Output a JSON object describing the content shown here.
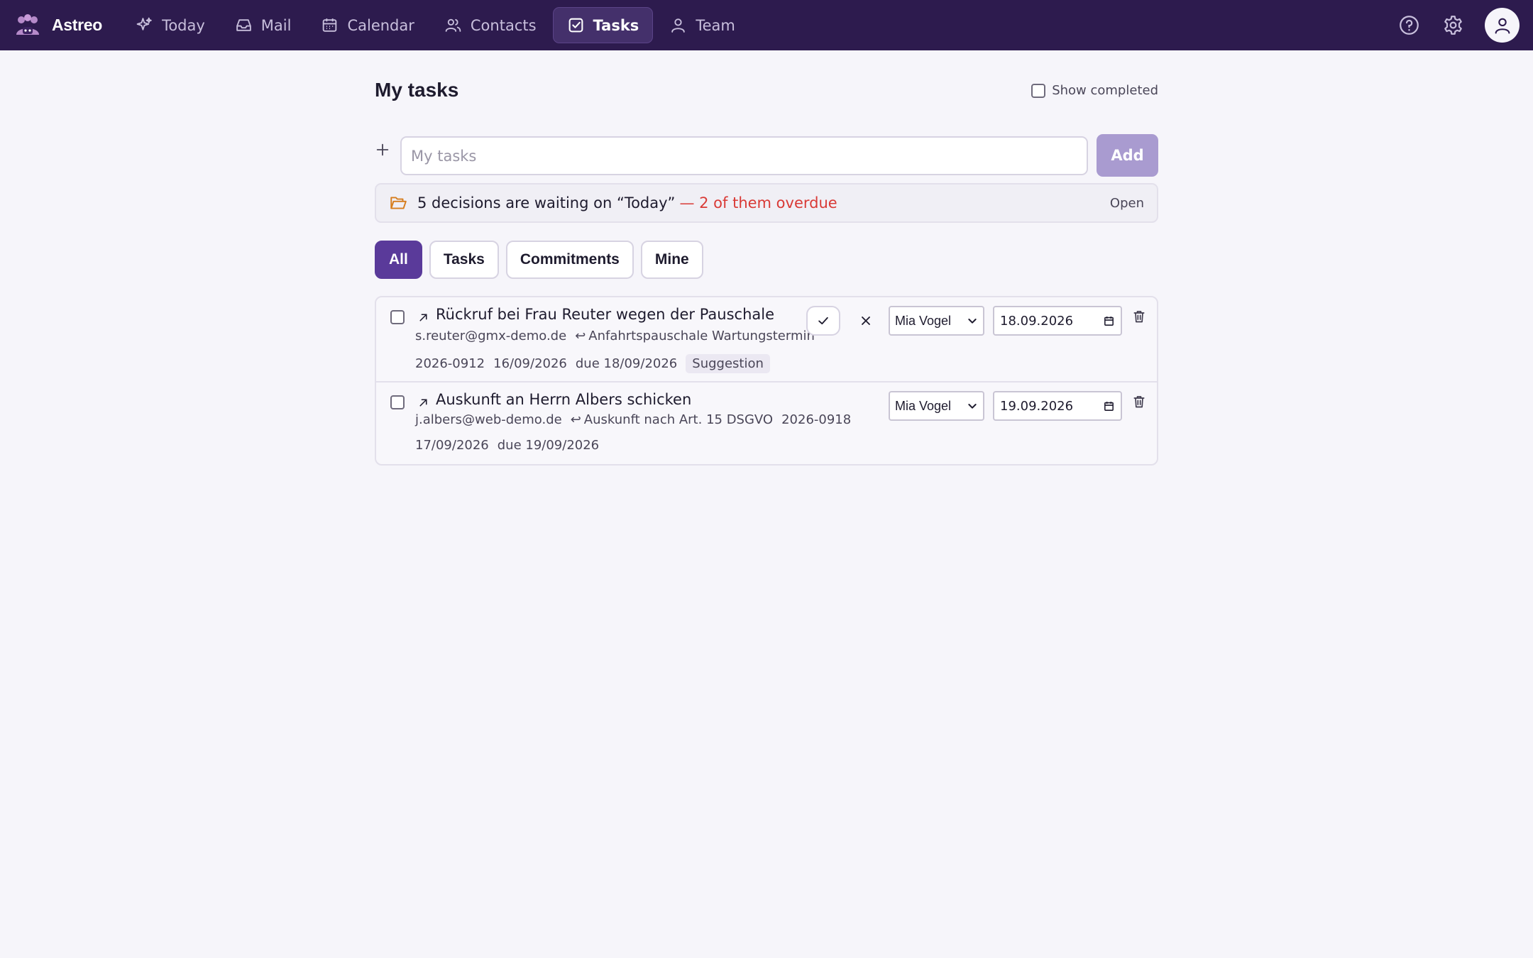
{
  "app": {
    "name": "Astreo"
  },
  "nav": {
    "items": [
      {
        "label": "Today",
        "icon": "sparkle-icon"
      },
      {
        "label": "Mail",
        "icon": "inbox-icon"
      },
      {
        "label": "Calendar",
        "icon": "calendar-icon"
      },
      {
        "label": "Contacts",
        "icon": "contacts-icon"
      },
      {
        "label": "Tasks",
        "icon": "checkbox-icon",
        "active": true
      },
      {
        "label": "Team",
        "icon": "person-icon"
      }
    ]
  },
  "header_actions": [
    "help-icon",
    "gear-icon",
    "avatar"
  ],
  "page": {
    "title": "My tasks",
    "show_completed_label": "Show completed",
    "show_completed_checked": false
  },
  "add_task": {
    "placeholder": "My tasks",
    "value": "",
    "button_label": "Add"
  },
  "notice": {
    "text": "5 decisions are waiting on “Today”",
    "overdue": "— 2 of them overdue",
    "action": "Open"
  },
  "filters": [
    {
      "label": "All",
      "active": true
    },
    {
      "label": "Tasks"
    },
    {
      "label": "Commitments"
    },
    {
      "label": "Mine"
    }
  ],
  "tasks": [
    {
      "title": "Rückruf bei Frau Reuter wegen der Pauschale",
      "email": "s.reuter@gmx-demo.de",
      "reference": "Anfahrtspauschale Wartungstermin",
      "id": "2026-0912",
      "created": "16/09/2026",
      "due": "due 18/09/2026",
      "tag": "Suggestion",
      "assignee": "Mia Vogel",
      "date": "18.09.2026",
      "done": false
    },
    {
      "title": "Auskunft an Herrn Albers schicken",
      "email": "j.albers@web-demo.de",
      "reference": "Auskunft nach Art. 15 DSGVO",
      "id": "2026-0918",
      "created": "17/09/2026",
      "due": "due 19/09/2026",
      "assignee": "Mia Vogel",
      "date": "19.09.2026",
      "done": false
    }
  ],
  "colors": {
    "topbar": "#2d1b4e",
    "accent": "#5a3a9a",
    "add_button": "#a99bd0",
    "overdue": "#d93a36",
    "folder_icon": "#d67d1e"
  }
}
